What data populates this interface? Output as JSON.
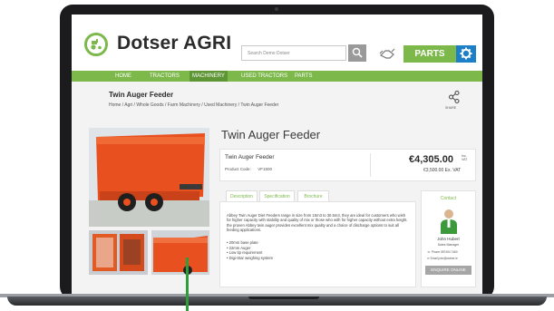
{
  "brand": {
    "name": "Dotser AGRI",
    "accent": "#7db84b",
    "blue": "#1c7fc8"
  },
  "header": {
    "search_placeholder": "Search Demo Dotser",
    "parts_label": "PARTS"
  },
  "nav": {
    "items": [
      {
        "label": "HOME"
      },
      {
        "label": "TRACTORS"
      },
      {
        "label": "MACHINERY",
        "active": true
      },
      {
        "label": "USED TRACTORS"
      },
      {
        "label": "PARTS"
      }
    ]
  },
  "page": {
    "title": "Twin Auger Feeder",
    "breadcrumb": [
      "Home",
      "Agri",
      "Whole Goods",
      "Farm Machinery",
      "Used Machinery",
      "Twin Auger Feeder"
    ],
    "share_label": "SHARE"
  },
  "product": {
    "title": "Twin Auger Feeder",
    "name": "Twin Auger Feeder",
    "code_label": "Product Code:",
    "code": "VF1500",
    "price": "€4,305.00",
    "price_inc": "Inc.",
    "price_vat": "VAT",
    "price_ex": "€3,500.00 Ex. VAT"
  },
  "tabs": [
    {
      "label": "Description",
      "active": true
    },
    {
      "label": "Specification"
    },
    {
      "label": "Brochure"
    }
  ],
  "description": {
    "text": "Abbey Twin Auger Diet Feeders range in size from 15m3 to 30.5m3, they are ideal for customers who wish for higher capacity with stability and quality of mix or those who with for higher capacity without extra height. the proven Abbey twin auger provides excellent mix quality and a choice of discharge options to suit all feeding applications.",
    "bullets": [
      "20mm base plate",
      "22mm Auger",
      "Low tip requirement",
      "Digi-Star weighing system"
    ]
  },
  "contact": {
    "title": "Contact",
    "name": "John Hubert",
    "role": "Sales Manager",
    "phone": "Phone 087454 7480",
    "email": "Email john@dotser.ie",
    "button": "ENQUIRE ONLINE"
  }
}
